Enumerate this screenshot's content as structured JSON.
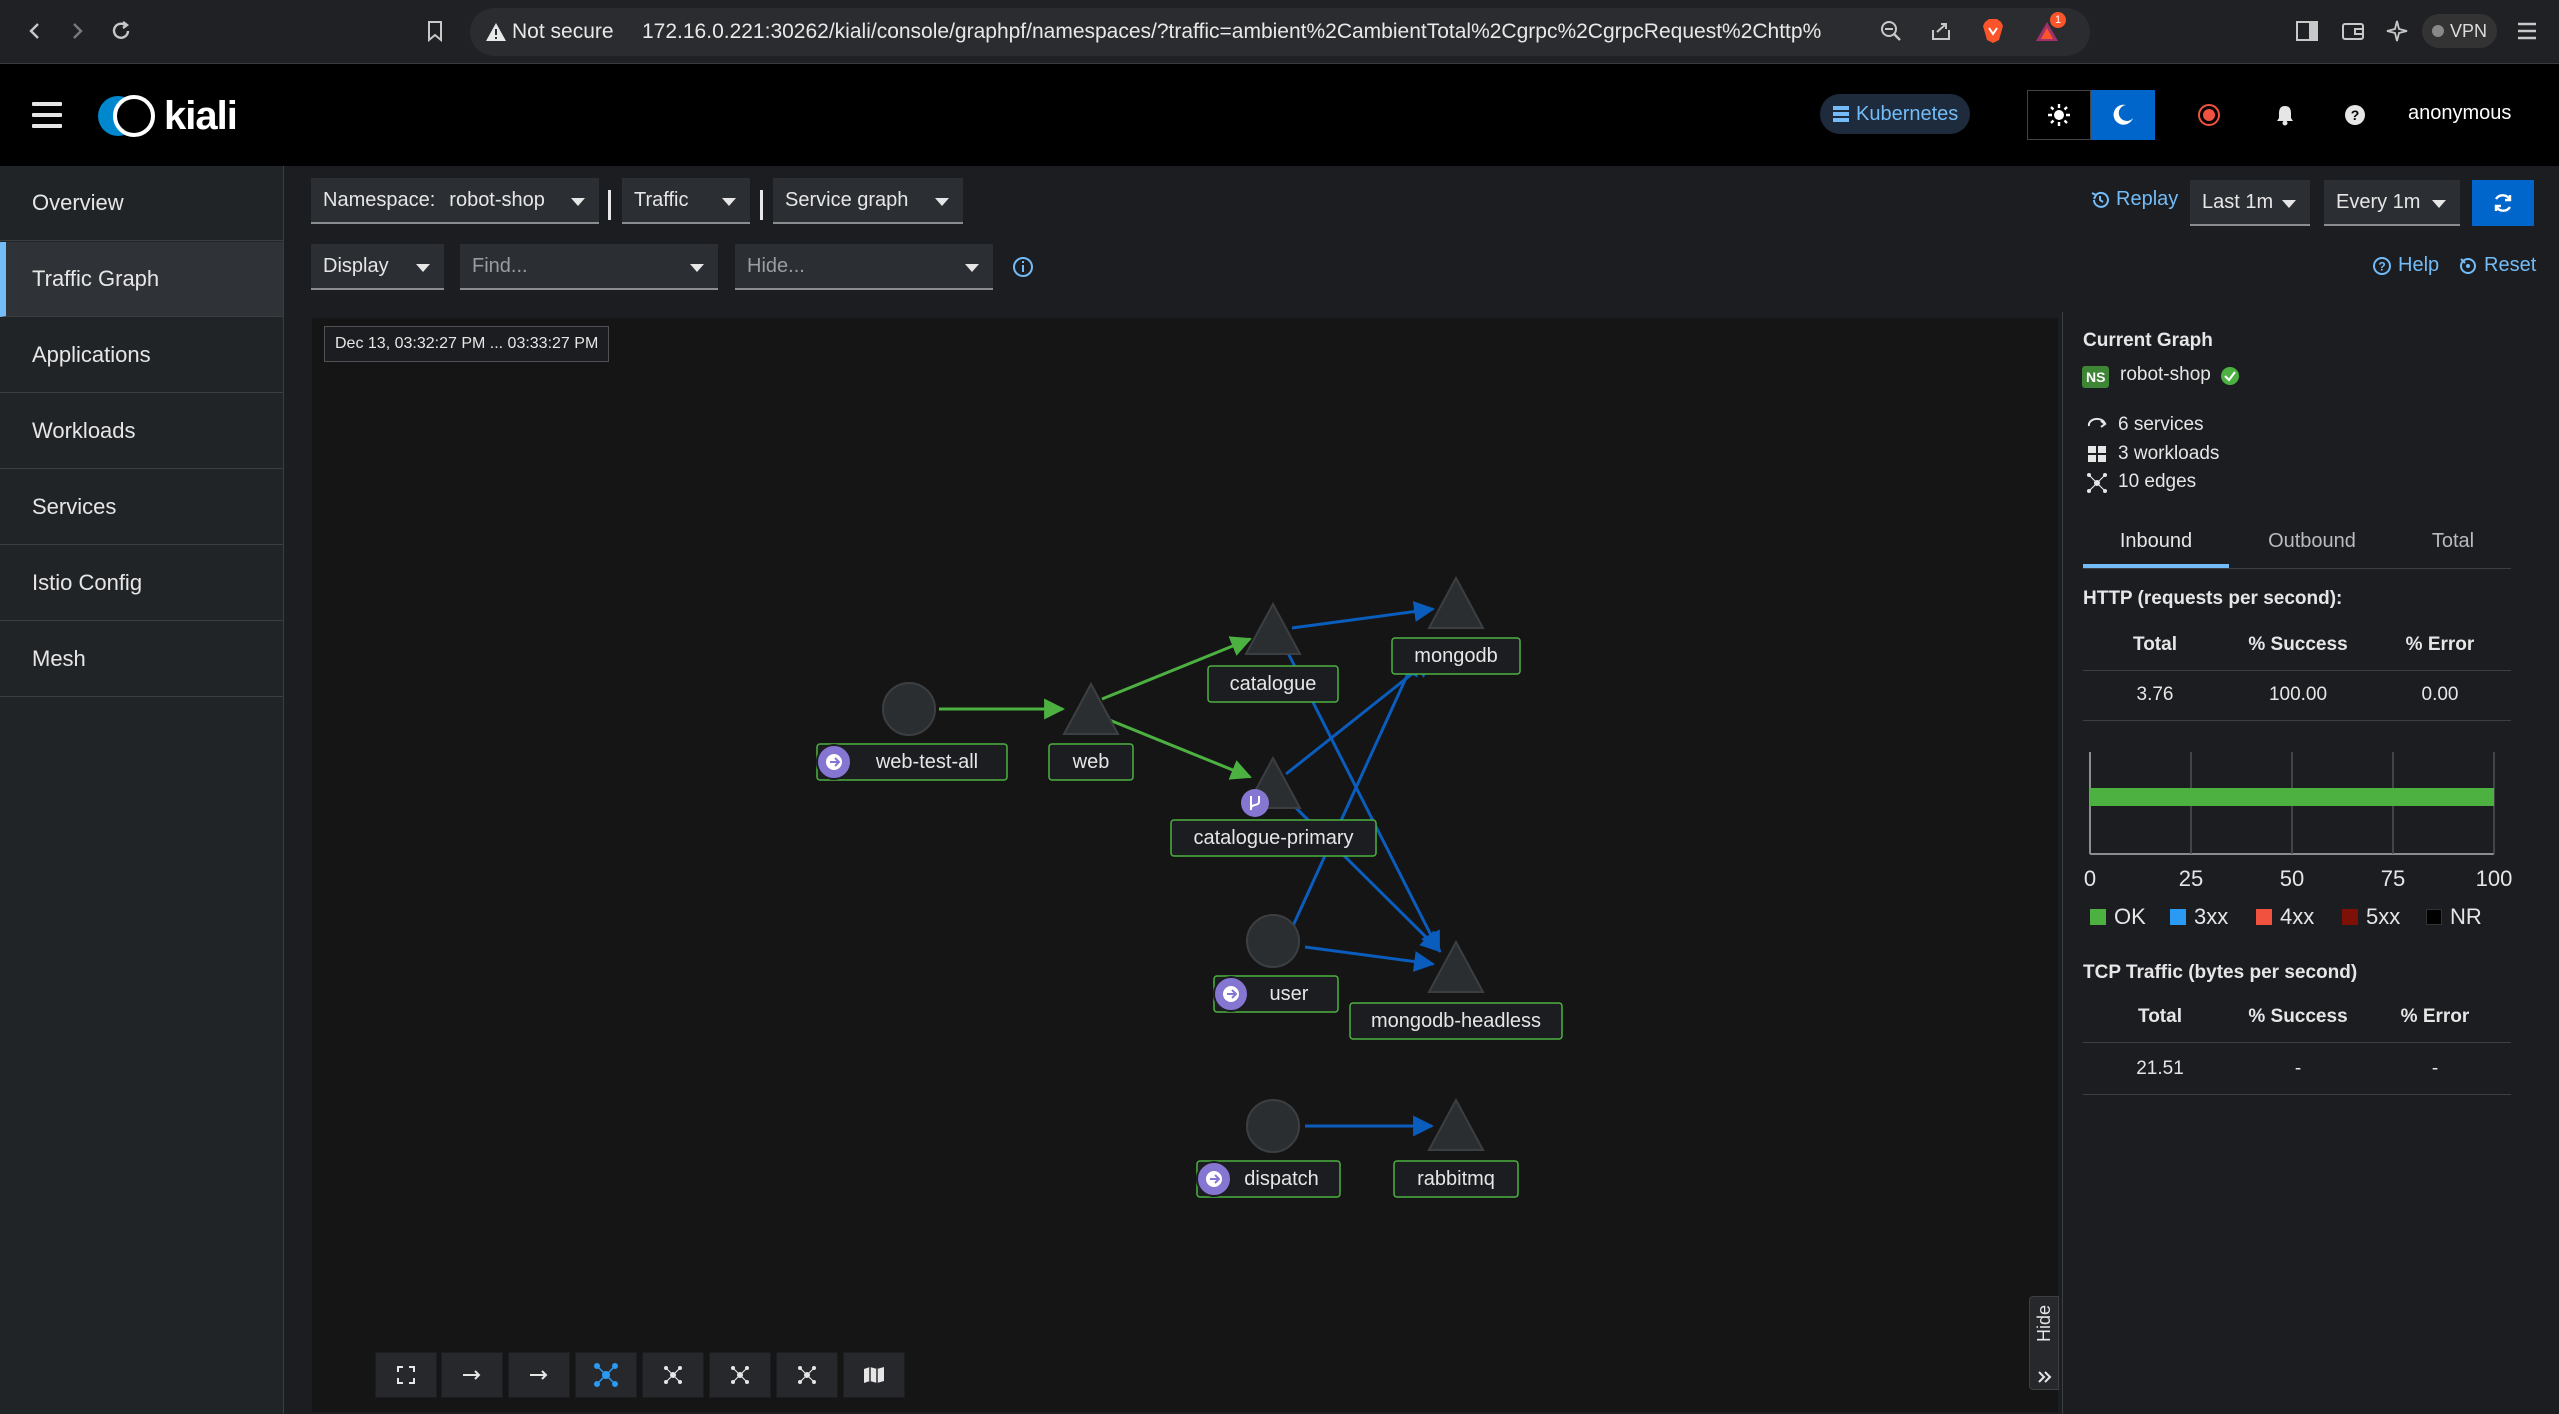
{
  "browser": {
    "security_label": "Not secure",
    "url": "172.16.0.221:30262/kiali/console/graphpf/namespaces/?traffic=ambient%2CambientTotal%2Cgrpc%2CgrpcRequest%2Chttp%2Ch...",
    "vpn_label": "VPN",
    "notification_count": "1"
  },
  "masthead": {
    "logo_text": "kiali",
    "cluster_label": "Kubernetes",
    "user": "anonymous"
  },
  "sidebar": {
    "items": [
      {
        "label": "Overview"
      },
      {
        "label": "Traffic Graph"
      },
      {
        "label": "Applications"
      },
      {
        "label": "Workloads"
      },
      {
        "label": "Services"
      },
      {
        "label": "Istio Config"
      },
      {
        "label": "Mesh"
      }
    ],
    "active": "Traffic Graph"
  },
  "toolbar": {
    "namespace_label": "Namespace:",
    "namespace_value": "robot-shop",
    "traffic_label": "Traffic",
    "graph_type": "Service graph",
    "display_label": "Display",
    "find_placeholder": "Find...",
    "hide_placeholder": "Hide...",
    "replay_label": "Replay",
    "duration": "Last 1m",
    "refresh_interval": "Every 1m",
    "help_label": "Help",
    "reset_label": "Reset"
  },
  "graph": {
    "time_range": "Dec 13, 03:32:27 PM ... 03:33:27 PM",
    "nodes": [
      {
        "id": "web-test-all",
        "label": "web-test-all",
        "shape": "circle",
        "badge": "ingress"
      },
      {
        "id": "web",
        "label": "web",
        "shape": "triangle"
      },
      {
        "id": "catalogue",
        "label": "catalogue",
        "shape": "triangle"
      },
      {
        "id": "catalogue-primary",
        "label": "catalogue-primary",
        "shape": "triangle",
        "badge": "virtual-service"
      },
      {
        "id": "mongodb",
        "label": "mongodb",
        "shape": "triangle"
      },
      {
        "id": "user",
        "label": "user",
        "shape": "circle",
        "badge": "ingress"
      },
      {
        "id": "mongodb-headless",
        "label": "mongodb-headless",
        "shape": "triangle"
      },
      {
        "id": "dispatch",
        "label": "dispatch",
        "shape": "circle",
        "badge": "ingress"
      },
      {
        "id": "rabbitmq",
        "label": "rabbitmq",
        "shape": "triangle"
      }
    ],
    "hide_label": "Hide"
  },
  "panel": {
    "title": "Current Graph",
    "ns_badge": "NS",
    "namespace": "robot-shop",
    "services": "6 services",
    "workloads": "3 workloads",
    "edges": "10 edges",
    "tabs": [
      "Inbound",
      "Outbound",
      "Total"
    ],
    "active_tab": "Inbound",
    "http": {
      "title": "HTTP (requests per second):",
      "headers": [
        "Total",
        "% Success",
        "% Error"
      ],
      "values": [
        "3.76",
        "100.00",
        "0.00"
      ]
    },
    "chart_data": {
      "type": "bar",
      "categories": [
        "OK",
        "3xx",
        "4xx",
        "5xx",
        "NR"
      ],
      "values": [
        100,
        0,
        0,
        0,
        0
      ],
      "xlim": [
        0,
        100
      ],
      "ticks": [
        "0",
        "25",
        "50",
        "75",
        "100"
      ],
      "colors": {
        "OK": "#4cb140",
        "3xx": "#2b9af3",
        "4xx": "#f0523f",
        "5xx": "#7d1007",
        "NR": "#000000"
      }
    },
    "tcp": {
      "title": "TCP Traffic (bytes per second)",
      "headers": [
        "Total",
        "% Success",
        "% Error"
      ],
      "values": [
        "21.51",
        "-",
        "-"
      ]
    }
  },
  "colors": {
    "accent": "#73bcf7",
    "primary": "#0066cc",
    "edge_http_ok": "#4cb140",
    "edge_tcp": "#0a5cbd"
  }
}
